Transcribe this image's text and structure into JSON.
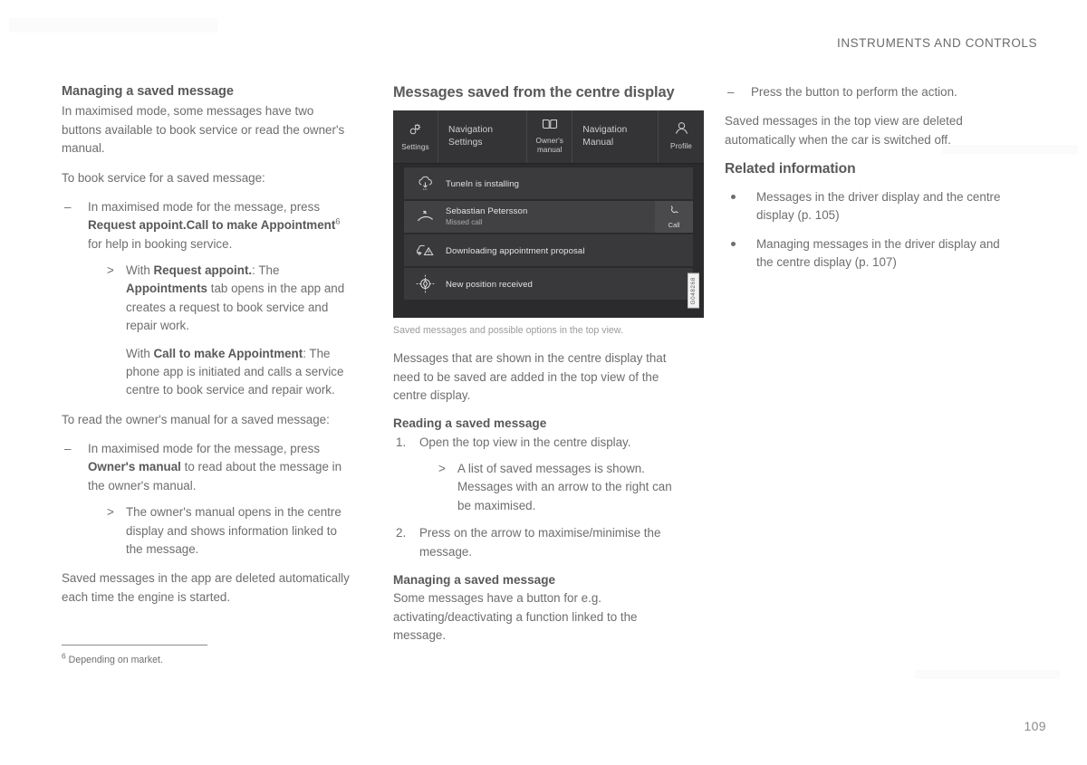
{
  "header": {
    "running_title": "INSTRUMENTS AND CONTROLS",
    "page_number": "109"
  },
  "left_column": {
    "title": "Managing a saved message",
    "intro": "In maximised mode, some messages have two buttons available to book service or read the owner's manual.",
    "lead_in": "To book service for a saved message:",
    "step1_pre": "In maximised mode for the message, press ",
    "step1_bold": "Request appoint.Call to make Appointment",
    "step1_footnote_marker": "6",
    "step1_post": " for help in booking service.",
    "sub1_pre": "With ",
    "sub1_bold": "Request appoint.",
    "sub1_post": ": The ",
    "sub1_bold2": "Appointments",
    "sub1_post2": " tab opens in the app and creates a request to book service and repair work.",
    "sub2_pre": "With ",
    "sub2_bold": "Call to make Appointment",
    "sub2_post": ": The phone app is initiated and calls a service centre to book service and repair work.",
    "lead_in2": "To read the owner's manual for a saved message:",
    "step2_pre": "In maximised mode for the message, press ",
    "step2_bold": "Owner's manual",
    "step2_post": " to read about the message in the owner's manual.",
    "sub3": "The owner's manual opens in the centre display and shows information linked to the message.",
    "closing": "Saved messages in the app are deleted automatically each time the engine is started.",
    "footnote_marker": "6",
    "footnote_text": " Depending on market."
  },
  "middle_column": {
    "title": "Messages saved from the centre display",
    "figure": {
      "image_code": "G048268",
      "caption": "Saved messages and possible options in the top view.",
      "tabs": [
        {
          "label": "Settings",
          "icon": "settings-gear-icon",
          "type": "icon"
        },
        {
          "label": "Navigation Settings",
          "icon": "",
          "type": "text"
        },
        {
          "label": "Owner's manual",
          "icon": "open-book-icon",
          "type": "icon"
        },
        {
          "label": "Navigation Manual",
          "icon": "",
          "type": "text"
        },
        {
          "label": "Profile",
          "icon": "person-profile-icon",
          "type": "icon"
        }
      ],
      "rows": [
        {
          "title": "TuneIn is installing",
          "subtitle": "",
          "icon": "cloud-download-icon",
          "button": ""
        },
        {
          "title": "Sebastian Petersson",
          "subtitle": "Missed call",
          "icon": "missed-call-icon",
          "button": "Call",
          "button_icon": "phone-handset-icon"
        },
        {
          "title": "Downloading appointment proposal",
          "subtitle": "",
          "icon": "car-warning-icon",
          "button": ""
        },
        {
          "title": "New position received",
          "subtitle": "",
          "icon": "compass-icon",
          "button": ""
        }
      ]
    },
    "body": "Messages that are shown in the centre display that need to be saved are added in the top view of the centre display.",
    "reading_title": "Reading a saved message",
    "read_step1": "Open the top view in the centre display.",
    "read_sub1": "A list of saved messages is shown. Messages with an arrow to the right can be maximised.",
    "read_step2": "Press on the arrow to maximise/minimise the message.",
    "managing_title": "Managing a saved message",
    "managing_body": "Some messages have a button for e.g. activating/deactivating a function linked to the message."
  },
  "right_column": {
    "dash_item": "Press the button to perform the action.",
    "body": "Saved messages in the top view are deleted automatically when the car is switched off.",
    "related_title": "Related information",
    "related_items": [
      "Messages in the driver display and the centre display (p. 105)",
      "Managing messages in the driver display and the centre display (p. 107)"
    ]
  }
}
